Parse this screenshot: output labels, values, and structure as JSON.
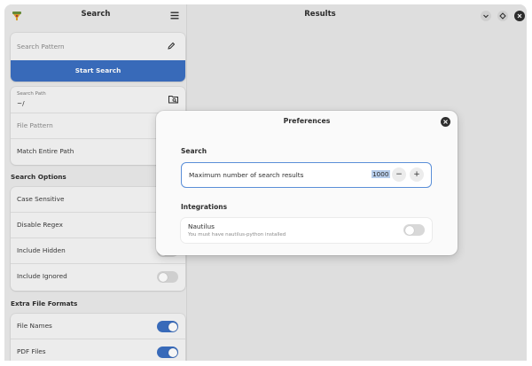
{
  "sidebar": {
    "title": "Search",
    "search_pattern_placeholder": "Search Pattern",
    "start_search_label": "Start Search",
    "search_path_label": "Search Path",
    "search_path_value": "~/",
    "file_pattern_placeholder": "File Pattern",
    "match_entire_path_label": "Match Entire Path",
    "search_options_title": "Search Options",
    "options": [
      {
        "label": "Case Sensitive",
        "on": false
      },
      {
        "label": "Disable Regex",
        "on": false
      },
      {
        "label": "Include Hidden",
        "on": false
      },
      {
        "label": "Include Ignored",
        "on": false
      }
    ],
    "extra_formats_title": "Extra File Formats",
    "formats": [
      {
        "label": "File Names",
        "on": true
      },
      {
        "label": "PDF Files",
        "on": true
      }
    ]
  },
  "main": {
    "title": "Results"
  },
  "dialog": {
    "title": "Preferences",
    "search_section": "Search",
    "max_results_label": "Maximum number of search results",
    "max_results_value": "1000",
    "minus_label": "−",
    "plus_label": "+",
    "integrations_section": "Integrations",
    "nautilus_label": "Nautilus",
    "nautilus_subtitle": "You must have nautilus-python installed",
    "nautilus_on": false
  },
  "colors": {
    "accent": "#3b6fc1",
    "focus_ring": "#5b8fd8"
  }
}
